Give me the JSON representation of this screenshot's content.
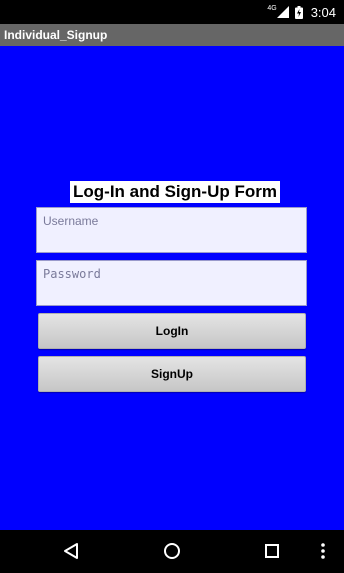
{
  "status_bar": {
    "network": "4G",
    "time": "3:04",
    "icons": [
      "signal-icon",
      "battery-icon"
    ]
  },
  "app": {
    "title": "Individual_Signup"
  },
  "form": {
    "title": "Log-In and Sign-Up Form",
    "username_placeholder": "Username",
    "password_placeholder": "Password",
    "login_label": "LogIn",
    "signup_label": "SignUp"
  },
  "nav_bar": {
    "icons": [
      "back-icon",
      "home-icon",
      "recent-apps-icon",
      "overflow-menu-icon"
    ]
  },
  "colors": {
    "background": "#0000ff",
    "title_bar": "#666666",
    "field_bg": "#f0f0ff"
  }
}
